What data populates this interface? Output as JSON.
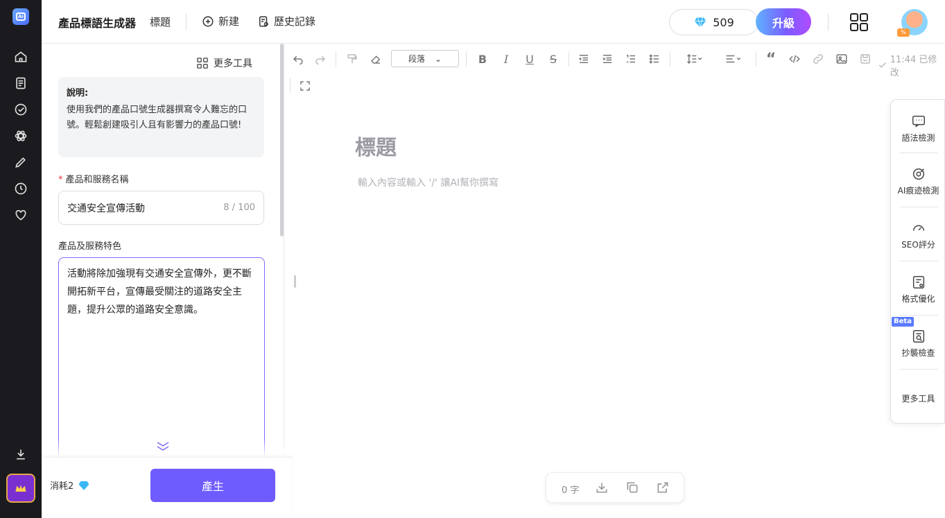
{
  "rail": {
    "items": [
      "home-icon",
      "doc-icon",
      "check-icon",
      "atom-icon",
      "pen-icon",
      "history-icon",
      "heart-icon",
      "download-icon",
      "crown-icon"
    ]
  },
  "header": {
    "title": "產品標語生成器",
    "subtitle": "標題",
    "new_label": "新建",
    "history_label": "歷史記錄",
    "gems": "509",
    "upgrade_label": "升級"
  },
  "left": {
    "more_tools": "更多工具",
    "info_title": "說明:",
    "info_desc": "使用我們的產品口號生成器撰寫令人難忘的口號。輕鬆創建吸引人且有影響力的產品口號!",
    "field1_label": "產品和服務名稱",
    "field1_value": "交通安全宣傳活動",
    "field1_count": "8 / 100",
    "field2_label": "產品及服務特色",
    "field2_value": "活動將除加強現有交通安全宣傳外，更不斷開拓新平台，宣傳最受關注的道路安全主題，提升公眾的道路安全意識。",
    "cost_label": "消耗2",
    "generate_label": "產生"
  },
  "toolbar": {
    "paragraph": "段落",
    "saved": "11:44 已修改"
  },
  "editor": {
    "title_placeholder": "標題",
    "body_placeholder": "輸入內容或輸入 '/' 讓AI幫你撰寫"
  },
  "sidebar": {
    "items": [
      "語法檢測",
      "AI痕迹檢測",
      "SEO評分",
      "格式優化",
      "抄襲檢查",
      "更多工具"
    ],
    "beta": "Beta"
  },
  "wordbar": {
    "count": "0 字"
  },
  "colors": {
    "accent": "#6f5cff",
    "rail": "#1b1b1f"
  }
}
